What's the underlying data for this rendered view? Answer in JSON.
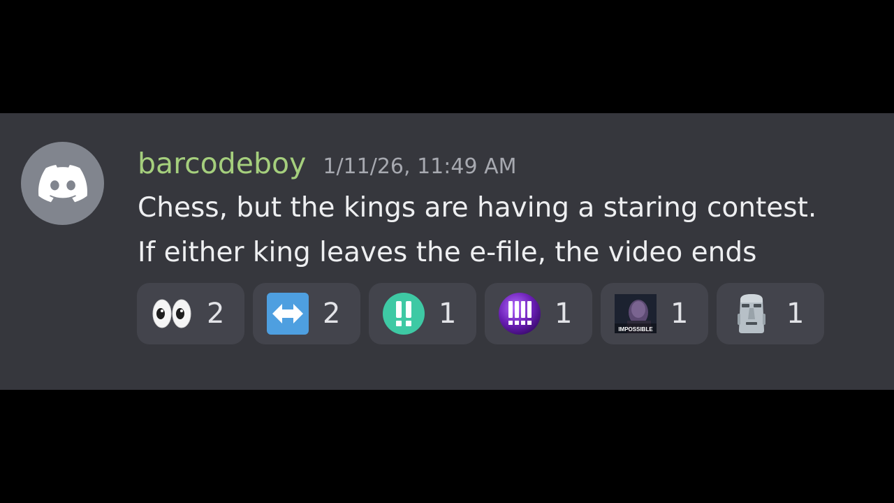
{
  "message": {
    "author": "barcodeboy",
    "timestamp": "1/11/26, 11:49 AM",
    "lines": [
      "Chess, but the kings are having a staring contest.",
      "If either king leaves the e-file, the video ends"
    ],
    "avatar_icon": "discord-logo-icon"
  },
  "reactions": [
    {
      "emoji": "eyes-icon",
      "count": "2"
    },
    {
      "emoji": "left-right-arrow-icon",
      "count": "2"
    },
    {
      "emoji": "double-exclamation-icon",
      "count": "1"
    },
    {
      "emoji": "quadruple-exclamation-icon",
      "count": "1"
    },
    {
      "emoji": "impossible-meme-icon",
      "count": "1",
      "image_text": "IMPOSSIBLE"
    },
    {
      "emoji": "moai-icon",
      "count": "1"
    }
  ],
  "colors": {
    "background": "#000000",
    "message_bg": "#36373d",
    "reaction_bg": "#43444c",
    "username": "#a5cf7d",
    "timestamp": "#a7a9b0",
    "text": "#eeeff1",
    "avatar_bg": "#81858e"
  }
}
